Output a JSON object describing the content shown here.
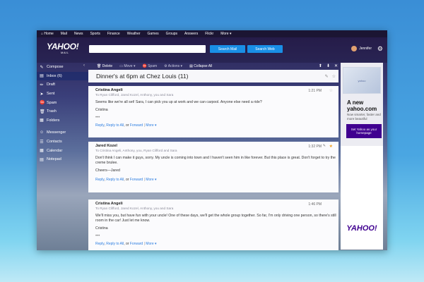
{
  "topnav": [
    "Home",
    "Mail",
    "News",
    "Sports",
    "Finance",
    "Weather",
    "Games",
    "Groups",
    "Answers",
    "Flickr",
    "More ▾"
  ],
  "brand": {
    "logo": "YAHOO!",
    "sub": "MAIL"
  },
  "search": {
    "mail_btn": "Search Mail",
    "web_btn": "Search Web"
  },
  "user": {
    "name": "Jennifer"
  },
  "sidebar": [
    {
      "label": "Compose",
      "icon": "✎"
    },
    {
      "label": "Inbox (6)",
      "icon": "▤",
      "active": true
    },
    {
      "label": "Draft",
      "icon": "✏"
    },
    {
      "label": "Sent",
      "icon": "➤"
    },
    {
      "label": "Spam",
      "icon": "⛔"
    },
    {
      "label": "Trash",
      "icon": "🗑"
    },
    {
      "label": "Folders",
      "icon": "▦"
    },
    {
      "label": "Messenger",
      "icon": "☺"
    },
    {
      "label": "Contacts",
      "icon": "☰"
    },
    {
      "label": "Calendar",
      "icon": "▦"
    },
    {
      "label": "Notepad",
      "icon": "▤"
    }
  ],
  "toolbar": {
    "delete": "Delete",
    "move": "Move ▾",
    "spam": "Spam",
    "actions": "Actions ▾",
    "collapse": "Collapse All"
  },
  "thread": {
    "subject": "Dinner's at 6pm at Chez Louis (11)"
  },
  "messages": [
    {
      "from": "Cristina Angeli",
      "to": "To Ryan Clifford, Jared Kozel, Anthony, you and Sara",
      "time": "1:21 PM",
      "body": [
        "Seems like we're all set! Sara, I can pick you up at work and we can carpool. Anyone else need a ride?",
        "Cristina"
      ],
      "dots": "•••"
    },
    {
      "from": "Jared Kozel",
      "to": "To Cristina Angeli, Anthony, you, Ryan Clifford and Sara",
      "time": "1:32 PM",
      "body": [
        "Don't think I can make it guys, sorry. My uncle is coming into town and I haven't seen him in like forever. But this place is great. Don't forget to try the creme brulee.",
        "Cheers—Jared"
      ],
      "dots": "•••"
    },
    {
      "from": "Cristina Angeli",
      "to": "To Ryan Clifford, Jared Kozel, Anthony, you and Sara",
      "time": "1:46 PM",
      "body": [
        "We'll miss you, but have fun with your uncle! One of these days, we'll get the whole group together.  So far, I'm only driving one person, so there's still room in the car!  Just let me know.",
        "Cristina"
      ],
      "dots": "•••"
    }
  ],
  "msg_actions": {
    "reply": "Reply",
    "reply_all": "Reply to All",
    "or": ", or",
    "forward": "Forward",
    "sep": "|",
    "more": "More ▾"
  },
  "ad": {
    "img_text": "yahoo",
    "title": "A new yahoo.com",
    "sub": "Now smarter, faster and more beautiful",
    "btn": "Set Yahoo as your homepage",
    "logo": "YAHOO!"
  },
  "colors": {
    "accent": "#198fe6",
    "brand": "#400090",
    "link": "#2c7de0"
  }
}
